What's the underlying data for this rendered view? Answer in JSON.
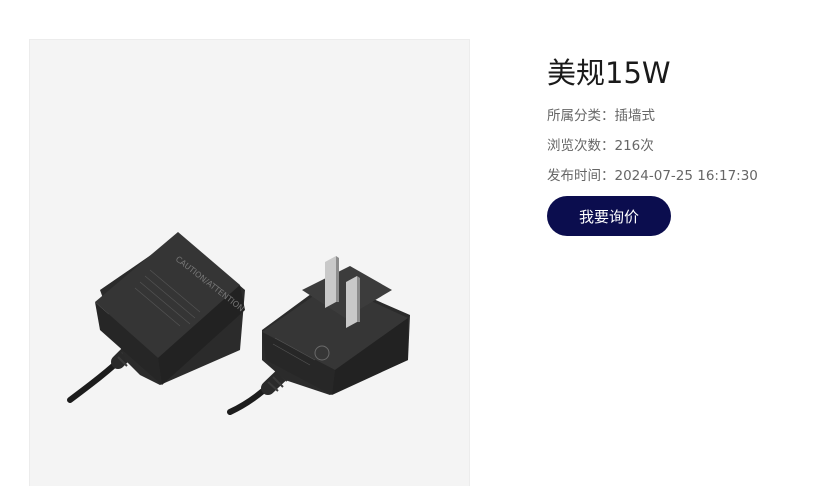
{
  "product": {
    "title": "美规15W",
    "category_label": "所属分类：",
    "category_value": "插墙式",
    "views_label": "浏览次数：",
    "views_value": "216次",
    "publish_label": "发布时间：",
    "publish_value": "2024-07-25 16:17:30",
    "inquiry_button": "我要询价"
  },
  "image": {
    "print_left": "CAUTION/ATTENTION"
  },
  "colors": {
    "button_bg": "#0b0d4e",
    "image_bg": "#f4f4f4",
    "title": "#1a1a1a",
    "meta": "#666666"
  }
}
